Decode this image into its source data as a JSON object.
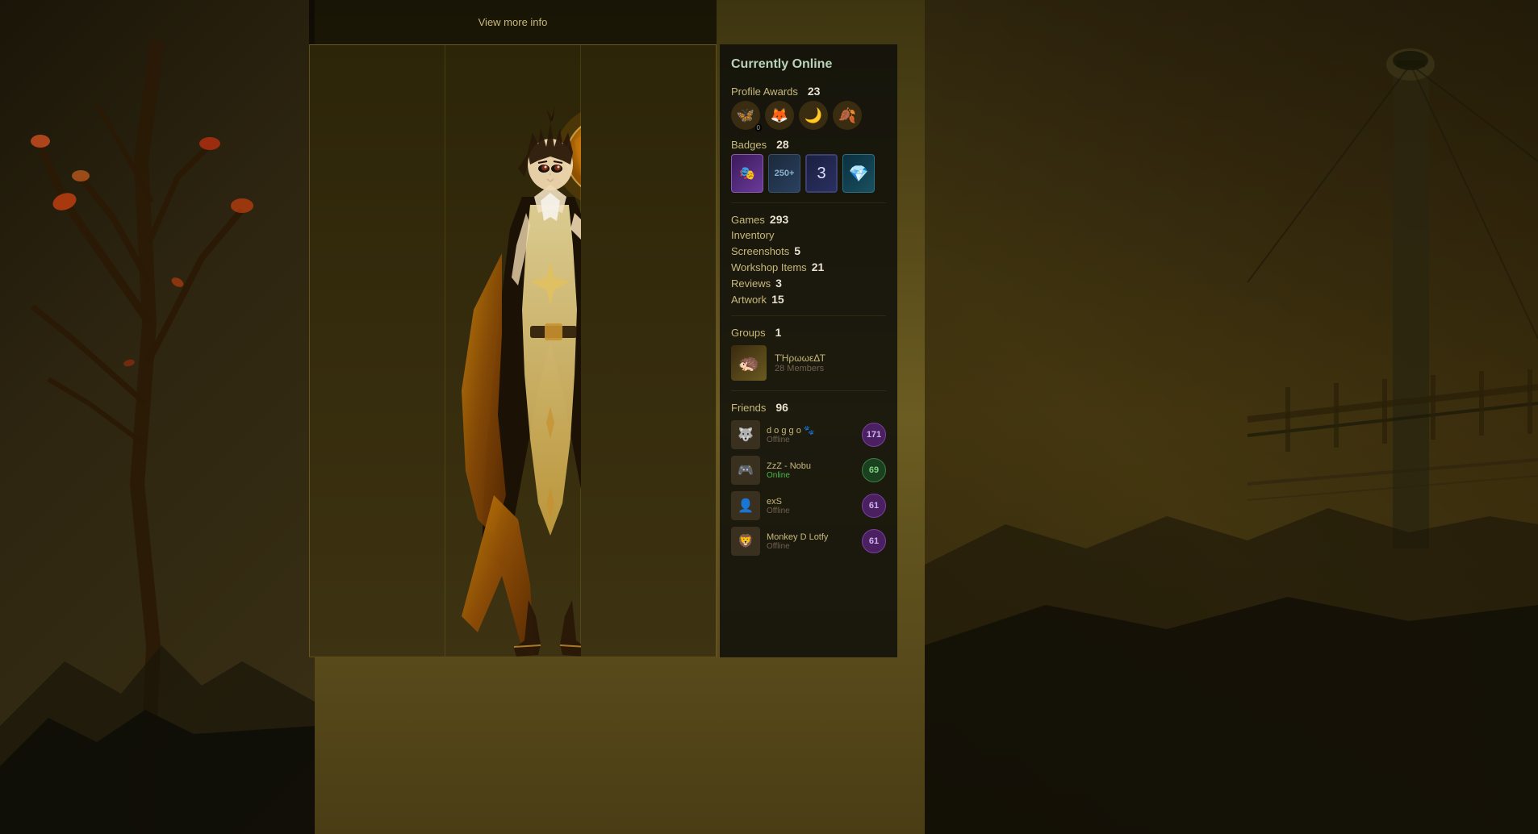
{
  "header": {
    "view_more_info": "View more info"
  },
  "status": {
    "label": "Currently Online"
  },
  "profile_awards": {
    "label": "Profile Awards",
    "count": 23,
    "icons": [
      "🦋",
      "🦊",
      "🌙",
      "🍂"
    ],
    "badge_nums": [
      "0",
      "",
      "",
      ""
    ]
  },
  "badges": {
    "label": "Badges",
    "count": 28,
    "items": [
      {
        "type": "purple",
        "icon": "🎭"
      },
      {
        "type": "dark",
        "text": "250+"
      },
      {
        "type": "navy",
        "text": "3"
      },
      {
        "type": "teal",
        "icon": "💎"
      }
    ]
  },
  "games": {
    "label": "Games",
    "count": 293
  },
  "inventory": {
    "label": "Inventory",
    "count": ""
  },
  "screenshots": {
    "label": "Screenshots",
    "count": 5
  },
  "workshop_items": {
    "label": "Workshop Items",
    "count": 21
  },
  "reviews": {
    "label": "Reviews",
    "count": 3
  },
  "artwork": {
    "label": "Artwork",
    "count": 15
  },
  "groups": {
    "label": "Groups",
    "count": 1,
    "items": [
      {
        "icon": "🦔",
        "name": "ΤΉρωωεΔΤ",
        "members": "28 Members"
      }
    ]
  },
  "friends": {
    "label": "Friends",
    "count": 96,
    "items": [
      {
        "icon": "🐺",
        "name": "d o g g o 🐾",
        "status": "Offline",
        "online": false,
        "level": 171,
        "level_type": "purple"
      },
      {
        "icon": "🎮",
        "name": "ZzZ - Nobu",
        "status": "Online",
        "online": true,
        "level": 69,
        "level_type": "green"
      },
      {
        "icon": "👤",
        "name": "exS",
        "status": "Offline",
        "online": false,
        "level": 61,
        "level_type": "purple"
      },
      {
        "icon": "🦁",
        "name": "Monkey D Lotfy",
        "status": "Offline",
        "online": false,
        "level": 61,
        "level_type": "purple"
      }
    ]
  }
}
